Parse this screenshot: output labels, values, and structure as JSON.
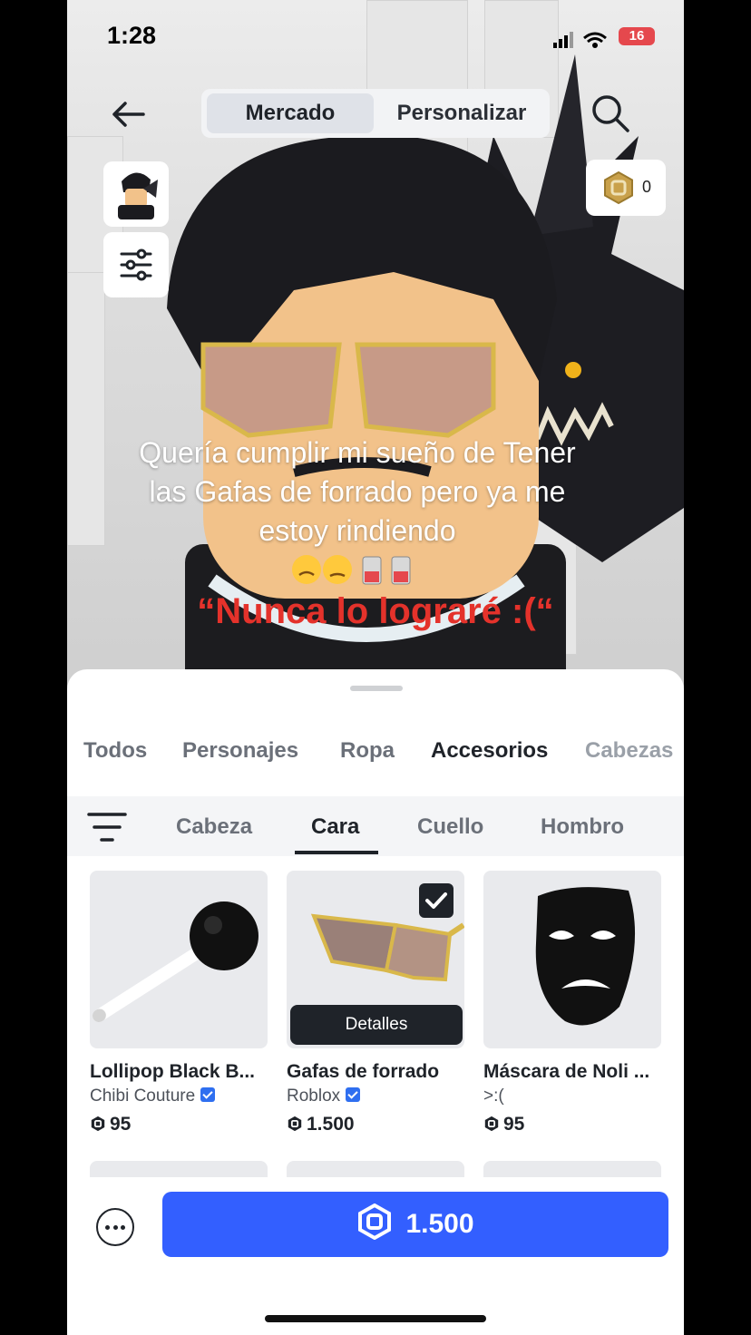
{
  "status_bar": {
    "time": "1:28",
    "battery": "16"
  },
  "header": {
    "tab_active": "Mercado",
    "tab_inactive": "Personalizar"
  },
  "robux_balance": "0",
  "overlay": {
    "caption": "Quería cumplir mi sueño de Tener las Gafas de forrado pero ya me estoy rindiendo",
    "quote": "“Nunca lo lograré :(“"
  },
  "categories": [
    "Todos",
    "Personajes",
    "Ropa",
    "Accesorios",
    "Cabezas"
  ],
  "active_category": "Accesorios",
  "subcategories": [
    "Cabeza",
    "Cara",
    "Cuello",
    "Hombro"
  ],
  "active_subcategory": "Cara",
  "items": [
    {
      "name": "Lollipop Black B...",
      "creator": "Chibi Couture",
      "verified": true,
      "price": "95"
    },
    {
      "name": "Gafas de forrado",
      "creator": "Roblox",
      "verified": true,
      "price": "1.500",
      "selected": true,
      "details_label": "Detalles"
    },
    {
      "name": "Máscara de Noli ...",
      "creator": ">:(",
      "verified": false,
      "price": "95"
    }
  ],
  "buy_button": {
    "price": "1.500"
  },
  "colors": {
    "accent": "#335FFF",
    "quote": "#E4322B",
    "dark": "#1F2329"
  },
  "icons": [
    "back-arrow-icon",
    "search-icon",
    "sliders-icon",
    "robux-icon",
    "filter-icon",
    "checkmark-icon",
    "verified-badge-icon",
    "more-icon"
  ]
}
